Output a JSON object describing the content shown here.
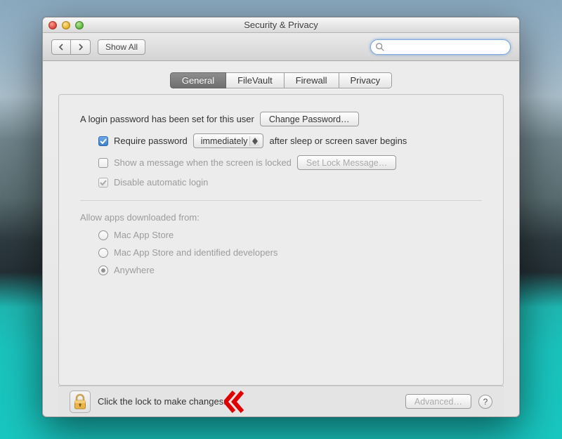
{
  "window": {
    "title": "Security & Privacy"
  },
  "toolbar": {
    "show_all": "Show All",
    "search_placeholder": ""
  },
  "tabs": [
    "General",
    "FileVault",
    "Firewall",
    "Privacy"
  ],
  "active_tab": 0,
  "general": {
    "login_pwd_text": "A login password has been set for this user",
    "change_pwd_btn": "Change Password…",
    "require_pwd_label": "Require password",
    "require_pwd_value": "immediately",
    "require_pwd_suffix": "after sleep or screen saver begins",
    "require_pwd_checked": true,
    "show_msg_label": "Show a message when the screen is locked",
    "show_msg_checked": false,
    "set_lock_msg_btn": "Set Lock Message…",
    "disable_autologin_label": "Disable automatic login",
    "disable_autologin_checked": true,
    "allow_apps_title": "Allow apps downloaded from:",
    "allow_options": [
      "Mac App Store",
      "Mac App Store and identified developers",
      "Anywhere"
    ],
    "allow_selected": 2
  },
  "footer": {
    "lock_text": "Click the lock to make changes.",
    "advanced_btn": "Advanced…",
    "help": "?"
  }
}
